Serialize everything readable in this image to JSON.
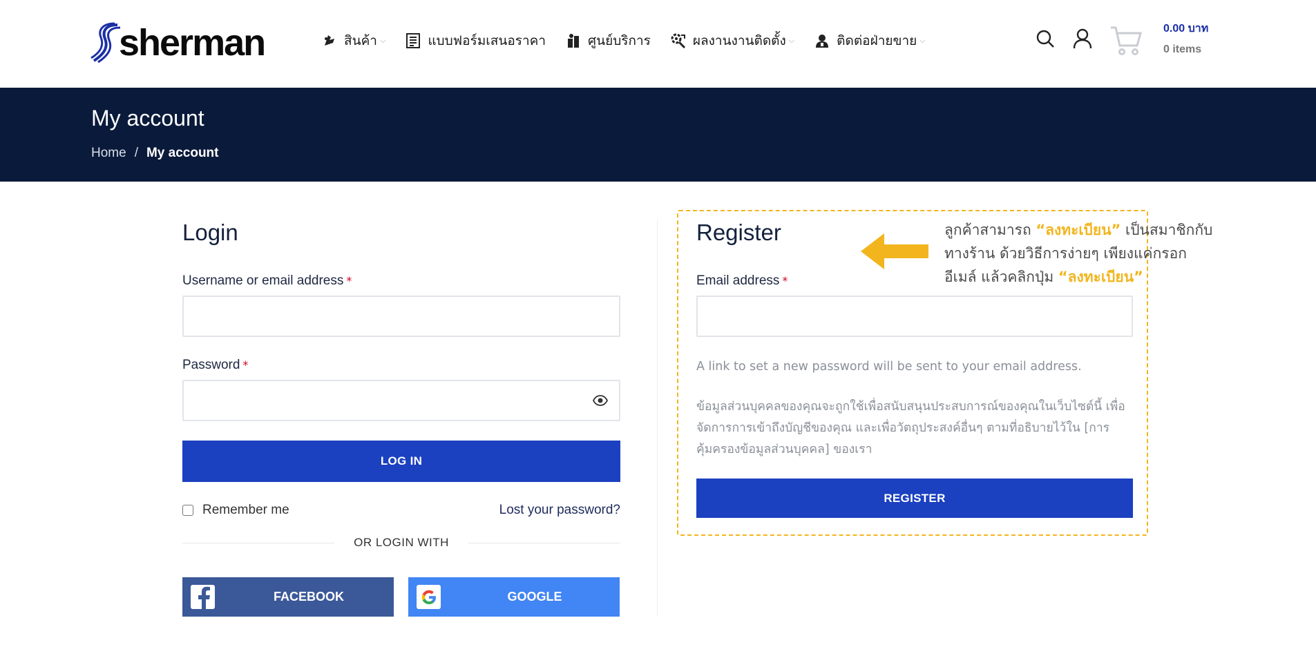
{
  "header": {
    "logo_text": "sherman",
    "nav": [
      {
        "label": "สินค้า",
        "icon": "products-icon",
        "has_dropdown": true
      },
      {
        "label": "แบบฟอร์มเสนอราคา",
        "icon": "quote-form-icon",
        "has_dropdown": false
      },
      {
        "label": "ศูนย์บริการ",
        "icon": "service-center-icon",
        "has_dropdown": false
      },
      {
        "label": "ผลงานงานติดตั้ง",
        "icon": "installation-works-icon",
        "has_dropdown": true
      },
      {
        "label": "ติดต่อฝ่ายขาย",
        "icon": "contact-sales-icon",
        "has_dropdown": true
      }
    ],
    "cart": {
      "total": "0.00 บาท",
      "items": "0 items"
    }
  },
  "titlebar": {
    "title": "My account",
    "breadcrumb": {
      "home": "Home",
      "separator": "/",
      "current": "My account"
    }
  },
  "login": {
    "title": "Login",
    "username_label": "Username or email address",
    "password_label": "Password",
    "required_mark": "*",
    "username_value": "",
    "password_value": "",
    "login_button": "LOG IN",
    "remember_label": "Remember me",
    "remember_checked": false,
    "lost_password": "Lost your password?",
    "or_login_with": "OR LOGIN WITH",
    "facebook_label": "FACEBOOK",
    "google_label": "GOOGLE"
  },
  "register": {
    "title": "Register",
    "email_label": "Email address",
    "required_mark": "*",
    "email_value": "",
    "notice": "A link to set a new password will be sent to your email address.",
    "privacy_line1": "ข้อมูลส่วนบุคคลของคุณจะถูกใช้เพื่อสนับสนุนประสบการณ์ของคุณในเว็บไซต์นี้ เพื่อ",
    "privacy_line2": "จัดการการเข้าถึงบัญชีของคุณ และเพื่อวัตถุประสงค์อื่นๆ ตามที่อธิบายไว้ใน [การ",
    "privacy_line3": "คุ้มครองข้อมูลส่วนบุคคล] ของเรา",
    "register_button": "REGISTER"
  },
  "annotation": {
    "line1_pre": "ลูกค้าสามารถ ",
    "line1_hl": "“ลงทะเบียน”",
    "line1_post": " เป็นสมาชิกกับ",
    "line2": "ทางร้าน ด้วยวิธีการง่ายๆ เพียงแค่กรอก",
    "line3_pre": "อีเมล์  แล้วคลิกปุ่ม ",
    "line3_hl": "“ลงทะเบียน”"
  },
  "colors": {
    "primary_button": "#1b40c0",
    "titlebar_bg": "#0a1a3a",
    "facebook": "#3b5998",
    "google": "#4285f4",
    "annotation_accent": "#f2b51e",
    "cart_total": "#1b2fa6"
  }
}
